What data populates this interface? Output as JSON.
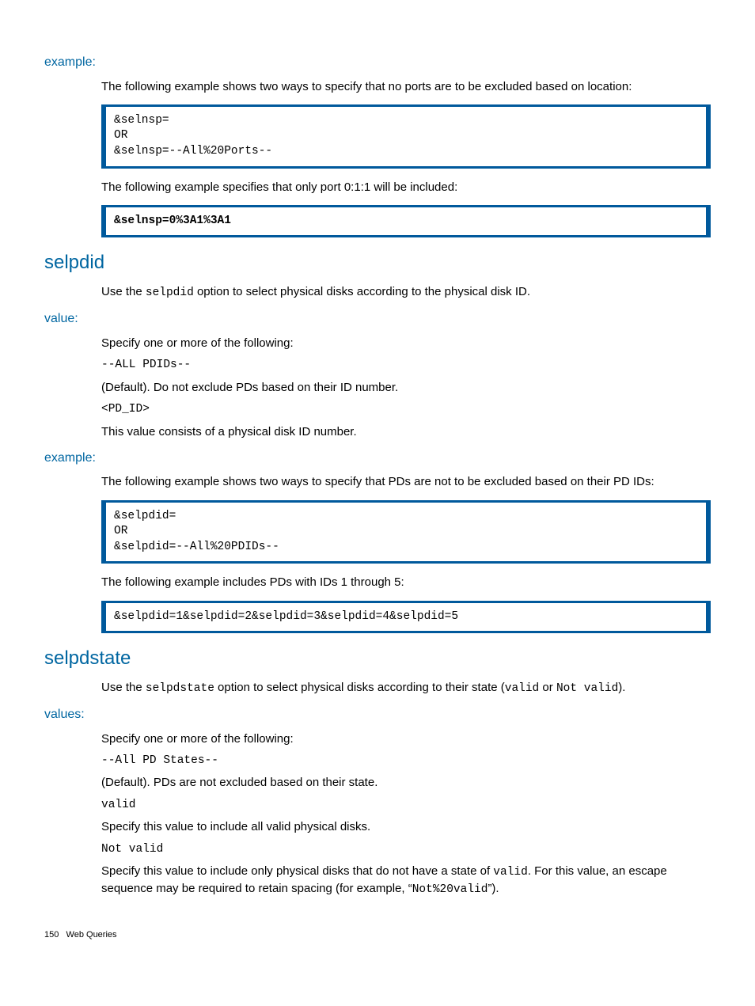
{
  "section_example1": {
    "heading": "example:",
    "p1": "The following example shows two ways to specify that no ports are to be excluded based on location:",
    "code1": "&selnsp=\nOR\n&selnsp=--All%20Ports--",
    "p2": "The following example specifies that only port 0:1:1 will be included:",
    "code2": "&selnsp=0%3A1%3A1"
  },
  "section_selpdid": {
    "heading": "selpdid",
    "intro_pre": "Use the ",
    "intro_mono": "selpdid",
    "intro_post": " option to select physical disks according to the physical disk ID.",
    "value_heading": "value:",
    "value_p1": "Specify one or more of the following:",
    "value_mono1": "--ALL PDIDs--",
    "value_p2": "(Default). Do not exclude PDs based on their ID number.",
    "value_mono2": "<PD_ID>",
    "value_p3": "This value consists of a physical disk ID number.",
    "example_heading": "example:",
    "example_p1": "The following example shows two ways to specify that PDs are not to be excluded based on their PD IDs:",
    "example_code1": "&selpdid=\nOR\n&selpdid=--All%20PDIDs--",
    "example_p2": "The following example includes PDs with IDs 1 through 5:",
    "example_code2": "&selpdid=1&selpdid=2&selpdid=3&selpdid=4&selpdid=5"
  },
  "section_selpdstate": {
    "heading": "selpdstate",
    "intro_pre": "Use the ",
    "intro_mono1": "selpdstate",
    "intro_mid": " option to select physical disks according to their state (",
    "intro_mono2": "valid",
    "intro_mid2": " or ",
    "intro_mono3": "Not valid",
    "intro_post": ").",
    "values_heading": "values:",
    "values_p1": "Specify one or more of the following:",
    "values_mono1": "--All PD States--",
    "values_p2": "(Default). PDs are not excluded based on their state.",
    "values_mono2": "valid",
    "values_p3": "Specify this value to include all valid physical disks.",
    "values_mono3": "Not valid",
    "values_p4_pre": "Specify this value to include only physical disks that do not have a state of ",
    "values_p4_mono1": "valid",
    "values_p4_mid": ". For this value, an escape sequence may be required to retain spacing (for example, “",
    "values_p4_mono2": "Not%20valid",
    "values_p4_post": "”)."
  },
  "footer": {
    "pagenum": "150",
    "label": "Web Queries"
  }
}
